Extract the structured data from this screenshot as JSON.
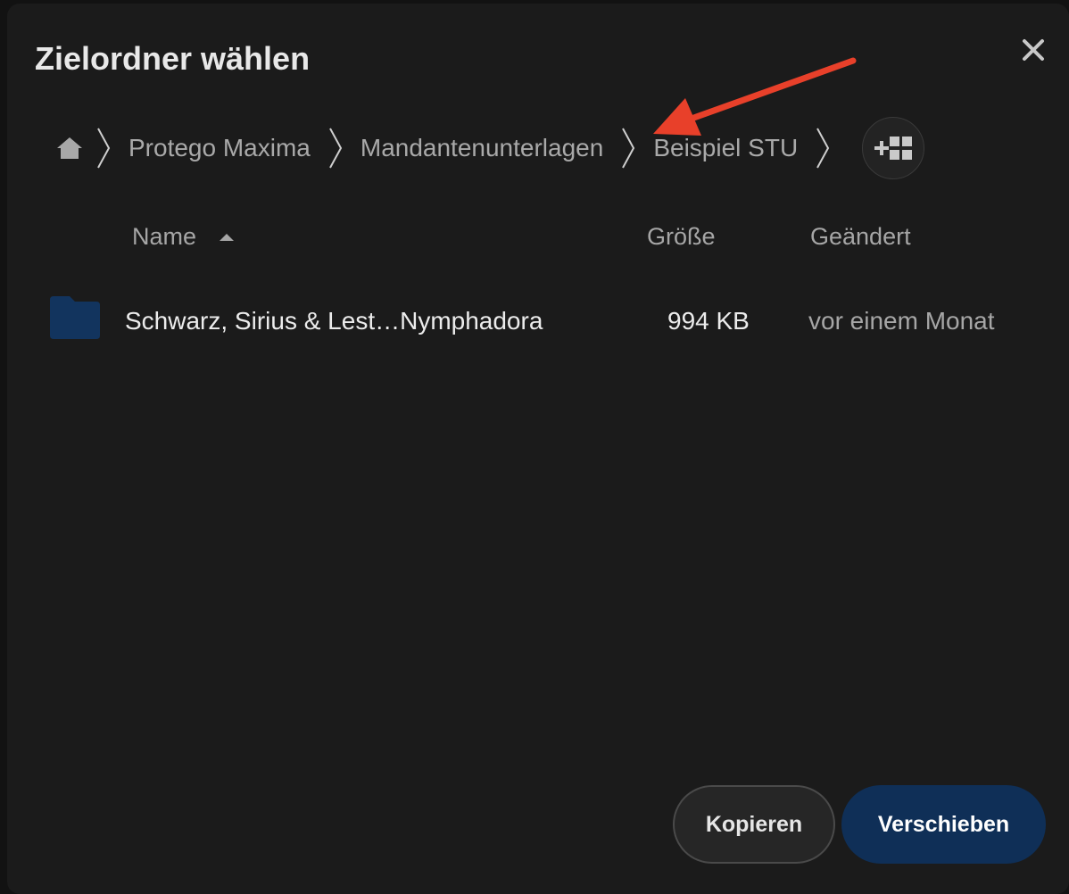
{
  "dialog": {
    "title": "Zielordner wählen",
    "close_icon": "close-icon"
  },
  "breadcrumb": {
    "home_icon": "home-icon",
    "items": [
      {
        "label": "Protego Maxima"
      },
      {
        "label": "Mandantenunterlagen"
      },
      {
        "label": "Beispiel STU"
      }
    ],
    "new_folder_icon": "new-folder-icon"
  },
  "columns": {
    "name": "Name",
    "size": "Größe",
    "modified": "Geändert",
    "sort": "ascending"
  },
  "rows": [
    {
      "icon": "folder-icon",
      "name": "Schwarz, Sirius & Lest…Nymphadora",
      "size": "994 KB",
      "modified": "vor einem Monat"
    }
  ],
  "buttons": {
    "copy": "Kopieren",
    "move": "Verschieben"
  },
  "annotation": {
    "arrow_color": "#e8402a"
  },
  "colors": {
    "accent": "#0f2f57",
    "folder": "#12345e"
  }
}
